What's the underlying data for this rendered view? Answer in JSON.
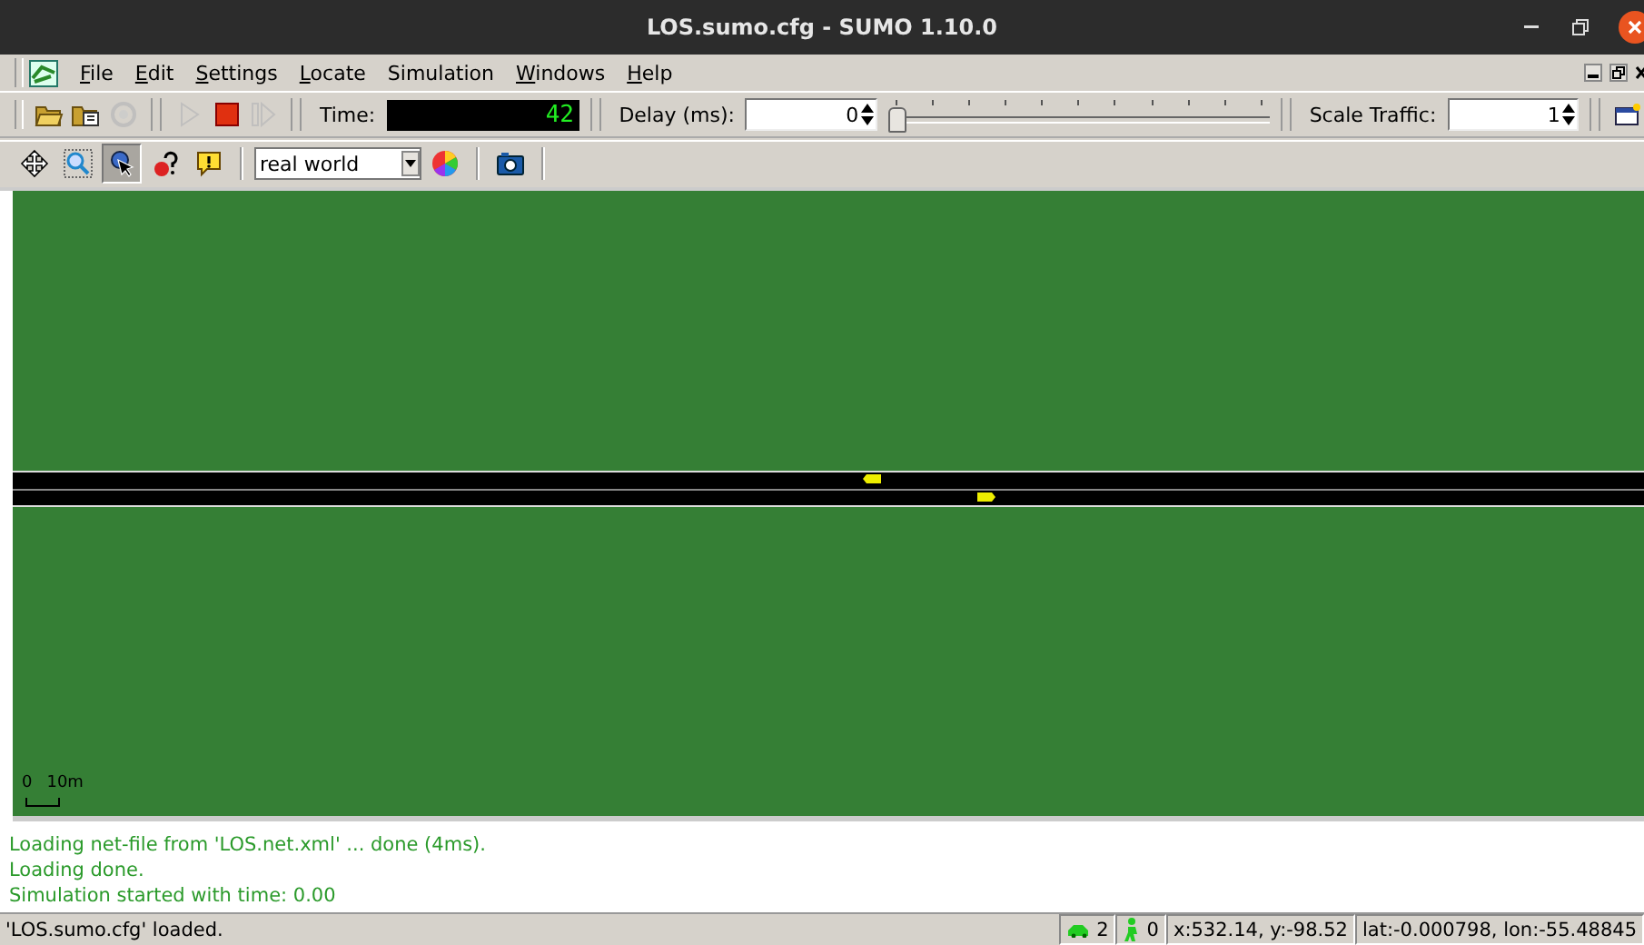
{
  "window": {
    "title": "LOS.sumo.cfg - SUMO 1.10.0"
  },
  "menu": [
    {
      "key": "F",
      "rest": "ile"
    },
    {
      "key": "E",
      "rest": "dit"
    },
    {
      "key": "S",
      "rest": "ettings"
    },
    {
      "key": "L",
      "rest": "ocate"
    },
    {
      "rest": "Simulation"
    },
    {
      "key": "W",
      "rest": "indows"
    },
    {
      "key": "H",
      "rest": "elp"
    }
  ],
  "sim_tools": [
    {
      "kind": "open",
      "disabled": false
    },
    {
      "kind": "reload",
      "disabled": false
    },
    {
      "kind": "reload-net",
      "disabled": true
    },
    {
      "kind": "run",
      "disabled": true
    },
    {
      "kind": "stop",
      "disabled": false
    },
    {
      "kind": "step",
      "disabled": true
    }
  ],
  "time": {
    "label": "Time:",
    "value": "42"
  },
  "delay": {
    "label": "Delay (ms):",
    "value": "0",
    "level": 0
  },
  "scale": {
    "label": "Scale Traffic:",
    "value": "1"
  },
  "view_tools": [
    {
      "kind": "recenter",
      "selected": false
    },
    {
      "kind": "zoom",
      "selected": false
    },
    {
      "kind": "locate",
      "selected": true
    },
    {
      "kind": "query",
      "selected": false
    },
    {
      "kind": "warning",
      "selected": false
    }
  ],
  "scheme": {
    "value": "real world"
  },
  "canvas": {
    "scale_start": "0",
    "scale_end": "10m",
    "vehicles": [
      {
        "kind": "westbound"
      },
      {
        "kind": "eastbound"
      }
    ]
  },
  "messages": [
    "Loading net-file from 'LOS.net.xml' ... done (4ms).",
    "Loading done.",
    "Simulation started with time: 0.00"
  ],
  "status": {
    "message": "'LOS.sumo.cfg' loaded.",
    "vehicles": "2",
    "persons": "0",
    "coords": "x:532.14, y:-98.52",
    "geo": "lat:-0.000798, lon:-55.48845"
  }
}
